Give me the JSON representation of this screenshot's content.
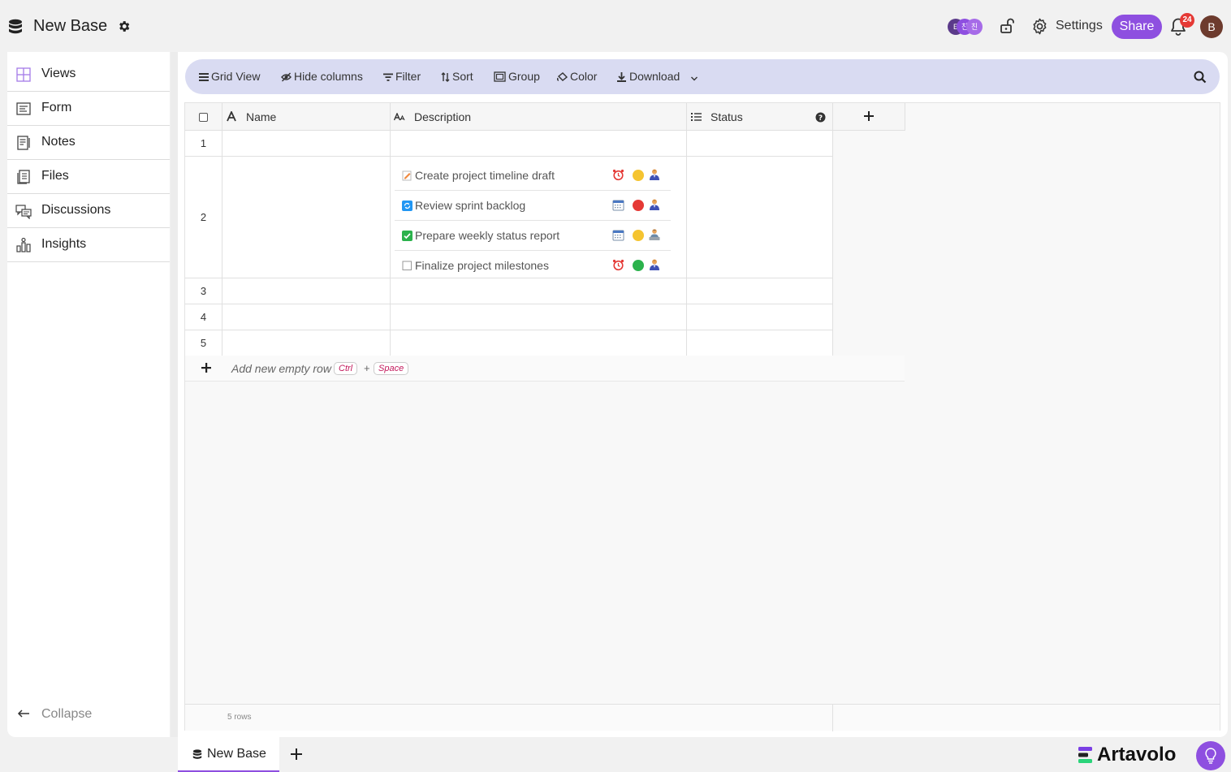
{
  "app": {
    "base_title": "New Base",
    "settings_label": "Settings",
    "share_label": "Share",
    "notification_count": "24",
    "user_initial": "B",
    "collaborators": [
      "E",
      "친",
      "친"
    ]
  },
  "sidebar": {
    "items": [
      {
        "label": "Views",
        "icon": "grid-icon"
      },
      {
        "label": "Form",
        "icon": "form-icon"
      },
      {
        "label": "Notes",
        "icon": "notes-icon"
      },
      {
        "label": "Files",
        "icon": "files-icon"
      },
      {
        "label": "Discussions",
        "icon": "discussions-icon"
      },
      {
        "label": "Insights",
        "icon": "insights-icon"
      }
    ],
    "collapse_label": "Collapse"
  },
  "toolbar": {
    "grid_view": "Grid View",
    "hide_columns": "Hide columns",
    "filter": "Filter",
    "sort": "Sort",
    "group": "Group",
    "color": "Color",
    "download": "Download"
  },
  "table": {
    "columns": [
      "Name",
      "Description",
      "Status"
    ],
    "row_numbers": [
      "1",
      "2",
      "3",
      "4",
      "5"
    ],
    "description_items": [
      {
        "text": "Create project timeline draft",
        "check_icon": "memo-icon",
        "time_icon": "alarm-clock-icon",
        "status_color": "#f5c430",
        "person_icon": "person-icon"
      },
      {
        "text": "Review sprint backlog",
        "check_icon": "refresh-icon",
        "time_icon": "calendar-icon",
        "status_color": "#e53935",
        "person_icon": "person-icon"
      },
      {
        "text": "Prepare weekly status report",
        "check_icon": "checked-box-icon",
        "time_icon": "calendar-icon",
        "status_color": "#f5c430",
        "person_icon": "person-laptop-icon"
      },
      {
        "text": "Finalize project milestones",
        "check_icon": "empty-box-icon",
        "time_icon": "alarm-clock-icon",
        "status_color": "#2bb24c",
        "person_icon": "person-icon"
      }
    ],
    "add_row_label": "Add new empty row",
    "shortcut_ctrl": "Ctrl",
    "shortcut_plus": "+",
    "shortcut_space": "Space",
    "row_count": "5 rows"
  },
  "bottom": {
    "tab_label": "New Base",
    "logo_text": "Artavolo"
  },
  "colors": {
    "accent": "#8e4fe0",
    "toolbar_bg": "#d9dbf2"
  }
}
